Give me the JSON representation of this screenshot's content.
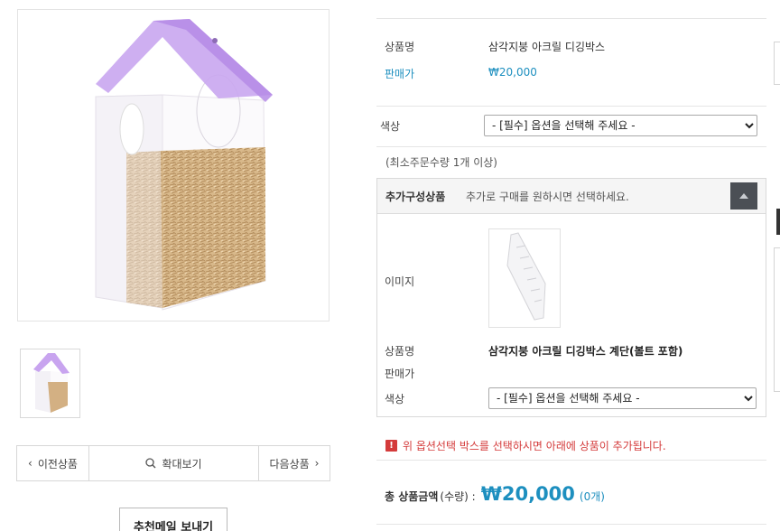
{
  "gallery": {
    "main_image_alt": "",
    "thumbnail_alt": ""
  },
  "product_nav": {
    "prev_label": "이전상품",
    "zoom_label": "확대보기",
    "next_label": "다음상품"
  },
  "recommend_mail_label": "추천메일 보내기",
  "info": {
    "name_label": "상품명",
    "name_value": "삼각지붕 아크릴 디깅박스",
    "price_label": "판매가",
    "price_value": "₩20,000"
  },
  "option": {
    "color_label": "색상",
    "color_select_value": "- [필수] 옵션을 선택해 주세요 -",
    "min_order_text": "(최소주문수량 1개 이상)"
  },
  "addon": {
    "title": "추가구성상품",
    "description": "추가로 구매를 원하시면 선택하세요.",
    "image_label": "이미지",
    "name_label": "상품명",
    "name_value": "삼각지붕 아크릴 디깅박스 계단(볼트 포함)",
    "price_label": "판매가",
    "color_label": "색상",
    "color_select_value": "- [필수] 옵션을 선택해 주세요 -"
  },
  "notice": {
    "icon": "!",
    "text": "위 옵션선택 박스를 선택하시면 아래에 상품이 추가됩니다."
  },
  "total": {
    "label": "총 상품금액",
    "qty_label": "(수량) :",
    "amount": "₩20,000",
    "count": "(0개)"
  },
  "colors": {
    "accent_blue": "#1d8fbf",
    "notice_red": "#d43b3b",
    "roof_purple": "#c7a4ef"
  }
}
